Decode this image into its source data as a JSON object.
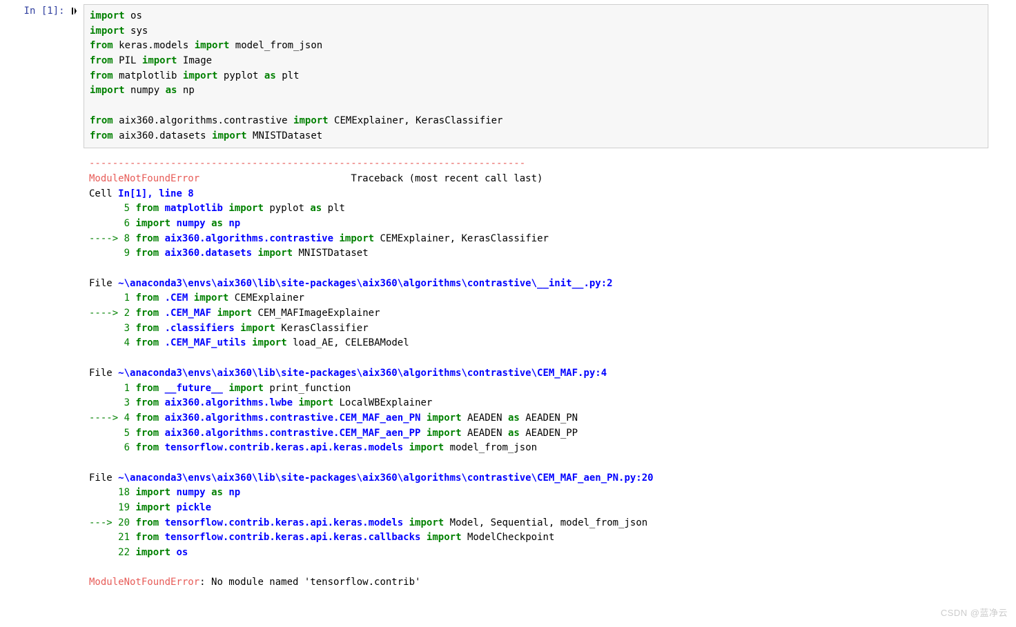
{
  "prompt": "In [1]:",
  "code": {
    "l1": {
      "a": "import",
      "b": "os"
    },
    "l2": {
      "a": "import",
      "b": "sys"
    },
    "l3": {
      "a": "from",
      "b": "keras.models",
      "c": "import",
      "d": "model_from_json"
    },
    "l4": {
      "a": "from",
      "b": "PIL",
      "c": "import",
      "d": "Image"
    },
    "l5": {
      "a": "from",
      "b": "matplotlib",
      "c": "import",
      "d": "pyplot",
      "e": "as",
      "f": "plt"
    },
    "l6": {
      "a": "import",
      "b": "numpy",
      "c": "as",
      "d": "np"
    },
    "l7": {
      "a": "from",
      "b": "aix360.algorithms.contrastive",
      "c": "import",
      "d": "CEMExplainer, KerasClassifier"
    },
    "l8": {
      "a": "from",
      "b": "aix360.datasets",
      "c": "import",
      "d": "MNISTDataset"
    }
  },
  "tb": {
    "sep": "---------------------------------------------------------------------------",
    "head_err": "ModuleNotFoundError",
    "head_msg": "Traceback (most recent call last)",
    "cell_label_a": "Cell ",
    "cell_label_b": "In[1], line 8",
    "l5": {
      "no": "      5",
      "a": "from",
      "b": "matplotlib",
      "c": "import",
      "d": "pyplot",
      "e": "as",
      "f": "plt"
    },
    "l6": {
      "no": "      6",
      "a": "import",
      "b": "numpy",
      "c": "as",
      "d": "np"
    },
    "l8": {
      "ar": "----> ",
      "no": "8",
      "a": "from",
      "b": "aix360.algorithms.contrastive",
      "c": "import",
      "d": "CEMExplainer, KerasClassifier"
    },
    "l9": {
      "no": "      9",
      "a": "from",
      "b": "aix360.datasets",
      "c": "import",
      "d": "MNISTDataset"
    },
    "file1_a": "File ",
    "file1_b": "~\\anaconda3\\envs\\aix360\\lib\\site-packages\\aix360\\algorithms\\contrastive\\__init__.py:2",
    "f1l1": {
      "no": "      1",
      "a": "from",
      "b": ".CEM",
      "c": "import",
      "d": "CEMExplainer"
    },
    "f1l2": {
      "ar": "----> ",
      "no": "2",
      "a": "from",
      "b": ".CEM_MAF",
      "c": "import",
      "d": "CEM_MAFImageExplainer"
    },
    "f1l3": {
      "no": "      3",
      "a": "from",
      "b": ".classifiers",
      "c": "import",
      "d": "KerasClassifier"
    },
    "f1l4": {
      "no": "      4",
      "a": "from",
      "b": ".CEM_MAF_utils",
      "c": "import",
      "d": "load_AE, CELEBAModel"
    },
    "file2_a": "File ",
    "file2_b": "~\\anaconda3\\envs\\aix360\\lib\\site-packages\\aix360\\algorithms\\contrastive\\CEM_MAF.py:4",
    "f2l1": {
      "no": "      1",
      "a": "from",
      "b": "__future__",
      "c": "import",
      "d": "print_function"
    },
    "f2l3": {
      "no": "      3",
      "a": "from",
      "b": "aix360.algorithms.lwbe",
      "c": "import",
      "d": "LocalWBExplainer"
    },
    "f2l4": {
      "ar": "----> ",
      "no": "4",
      "a": "from",
      "b": "aix360.algorithms.contrastive.CEM_MAF_aen_PN",
      "c": "import",
      "d": "AEADEN",
      "e": "as",
      "f": "AEADEN_PN"
    },
    "f2l5": {
      "no": "      5",
      "a": "from",
      "b": "aix360.algorithms.contrastive.CEM_MAF_aen_PP",
      "c": "import",
      "d": "AEADEN",
      "e": "as",
      "f": "AEADEN_PP"
    },
    "f2l6": {
      "no": "      6",
      "a": "from",
      "b": "tensorflow.contrib.keras.api.keras.models",
      "c": "import",
      "d": "model_from_json"
    },
    "file3_a": "File ",
    "file3_b": "~\\anaconda3\\envs\\aix360\\lib\\site-packages\\aix360\\algorithms\\contrastive\\CEM_MAF_aen_PN.py:20",
    "f3l18": {
      "no": "     18",
      "a": "import",
      "b": "numpy",
      "c": "as",
      "d": "np"
    },
    "f3l19": {
      "no": "     19",
      "a": "import",
      "b": "pickle"
    },
    "f3l20": {
      "ar": "---> ",
      "no": "20",
      "a": "from",
      "b": "tensorflow.contrib.keras.api.keras.models",
      "c": "import",
      "d": "Model, Sequential, model_from_json"
    },
    "f3l21": {
      "no": "     21",
      "a": "from",
      "b": "tensorflow.contrib.keras.api.keras.callbacks",
      "c": "import",
      "d": "ModelCheckpoint"
    },
    "f3l22": {
      "no": "     22",
      "a": "import",
      "b": "os"
    },
    "final_err": "ModuleNotFoundError",
    "final_msg": ": No module named 'tensorflow.contrib'"
  },
  "watermark": "CSDN @蓝净云"
}
